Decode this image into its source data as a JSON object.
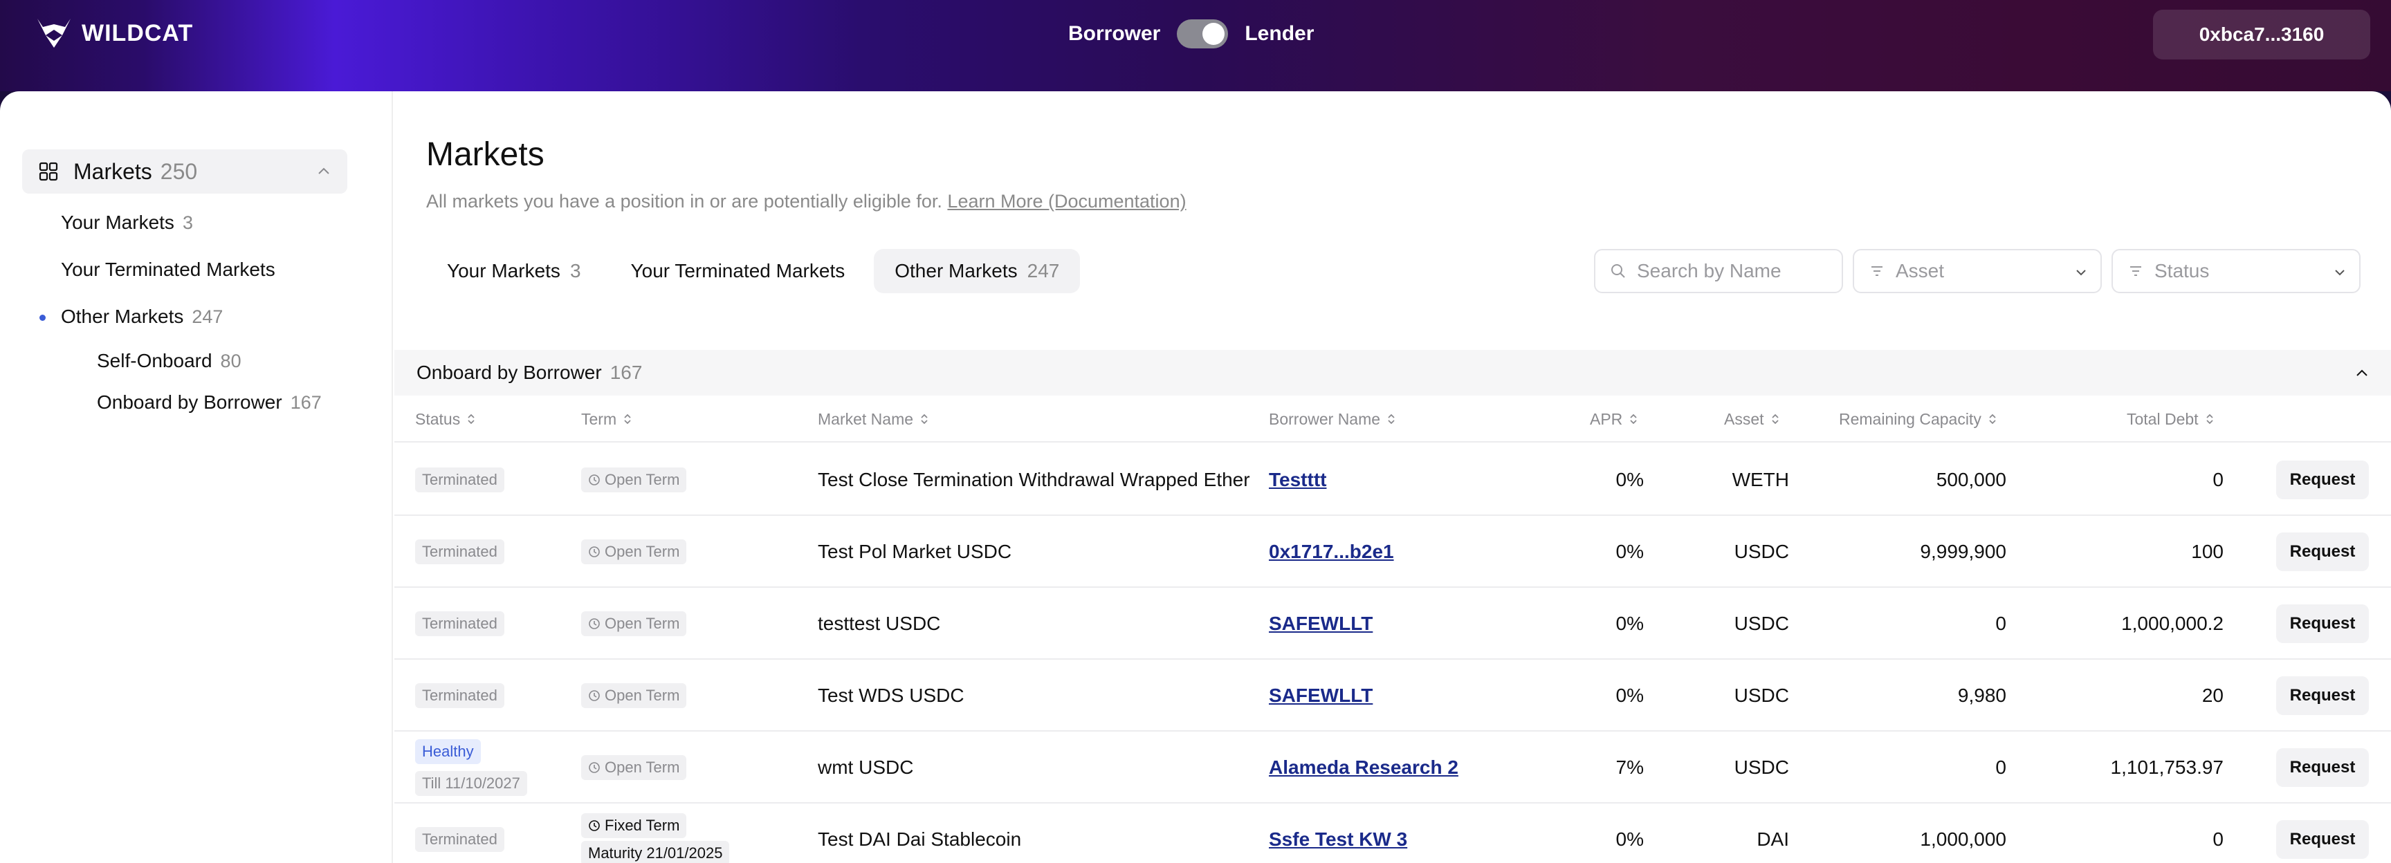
{
  "header": {
    "brand": "WILDCAT",
    "role_left": "Borrower",
    "role_right": "Lender",
    "wallet": "0xbca7...3160"
  },
  "sidebar": {
    "section_title": "Markets",
    "section_count": "250",
    "items": [
      {
        "label": "Your Markets",
        "count": "3"
      },
      {
        "label": "Your Terminated Markets",
        "count": ""
      },
      {
        "label": "Other Markets",
        "count": "247"
      }
    ],
    "subitems": [
      {
        "label": "Self-Onboard",
        "count": "80"
      },
      {
        "label": "Onboard by Borrower",
        "count": "167"
      }
    ]
  },
  "main": {
    "title": "Markets",
    "subtitle": "All markets you have a position in or are potentially eligible for.",
    "learn_more": "Learn More (Documentation)",
    "tabs": [
      {
        "label": "Your Markets",
        "count": "3"
      },
      {
        "label": "Your Terminated Markets",
        "count": ""
      },
      {
        "label": "Other Markets",
        "count": "247"
      }
    ],
    "search_placeholder": "Search by Name",
    "asset_filter": "Asset",
    "status_filter": "Status",
    "group": {
      "title": "Onboard by Borrower",
      "count": "167"
    }
  },
  "table": {
    "columns": [
      "Status",
      "Term",
      "Market Name",
      "Borrower Name",
      "APR",
      "Asset",
      "Remaining Capacity",
      "Total Debt"
    ],
    "action_label": "Request",
    "rows": [
      {
        "status": "Terminated",
        "status_extra": "",
        "term": "Open Term",
        "term_extra": "",
        "market": "Test Close Termination Withdrawal Wrapped Ether",
        "borrower": "Testttt",
        "apr": "0%",
        "asset": "WETH",
        "capacity": "500,000",
        "debt": "0"
      },
      {
        "status": "Terminated",
        "status_extra": "",
        "term": "Open Term",
        "term_extra": "",
        "market": "Test Pol Market USDC",
        "borrower": "0x1717...b2e1",
        "apr": "0%",
        "asset": "USDC",
        "capacity": "9,999,900",
        "debt": "100"
      },
      {
        "status": "Terminated",
        "status_extra": "",
        "term": "Open Term",
        "term_extra": "",
        "market": "testtest USDC",
        "borrower": "SAFEWLLT",
        "apr": "0%",
        "asset": "USDC",
        "capacity": "0",
        "debt": "1,000,000.2"
      },
      {
        "status": "Terminated",
        "status_extra": "",
        "term": "Open Term",
        "term_extra": "",
        "market": "Test WDS USDC",
        "borrower": "SAFEWLLT",
        "apr": "0%",
        "asset": "USDC",
        "capacity": "9,980",
        "debt": "20"
      },
      {
        "status": "Healthy",
        "status_extra": "Till 11/10/2027",
        "term": "Open Term",
        "term_extra": "",
        "market": "wmt USDC",
        "borrower": "Alameda Research 2",
        "apr": "7%",
        "asset": "USDC",
        "capacity": "0",
        "debt": "1,101,753.97"
      },
      {
        "status": "Terminated",
        "status_extra": "",
        "term": "Fixed Term",
        "term_extra": "Maturity 21/01/2025",
        "market": "Test DAI Dai Stablecoin",
        "borrower": "Ssfe Test KW 3",
        "apr": "0%",
        "asset": "DAI",
        "capacity": "1,000,000",
        "debt": "0"
      }
    ]
  }
}
